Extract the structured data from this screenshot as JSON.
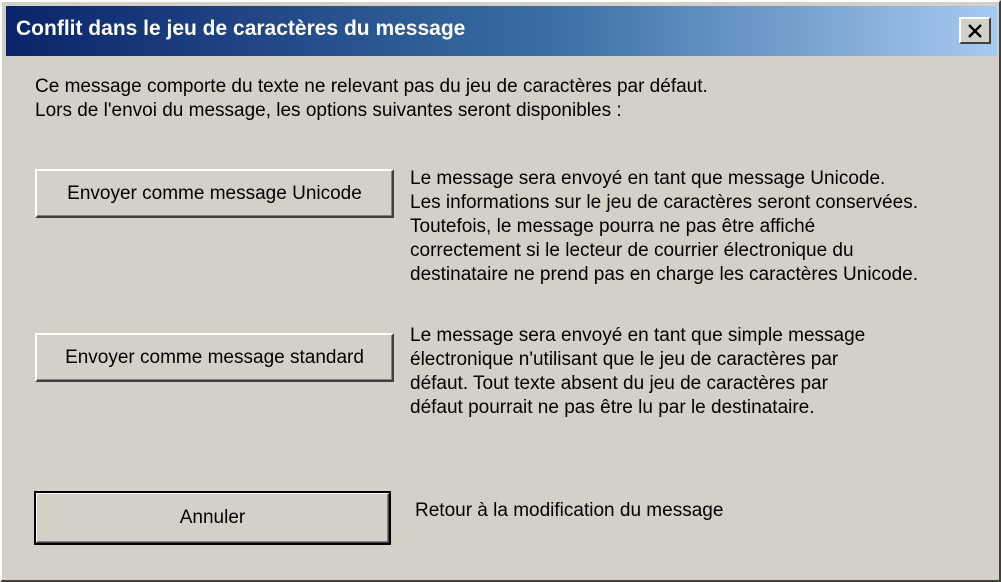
{
  "dialog": {
    "title": "Conflit dans le jeu de caractères du message",
    "intro_lines": [
      "Ce message comporte du texte ne relevant pas du jeu de caractères par défaut.",
      "Lors de l'envoi du message, les options suivantes seront disponibles :"
    ],
    "options": [
      {
        "button_label": "Envoyer comme message Unicode",
        "description_lines": [
          "Le message sera envoyé en tant que message Unicode.",
          "Les informations sur le jeu de caractères seront conservées.",
          "Toutefois, le message pourra ne pas être affiché",
          "correctement si le lecteur de courrier électronique du",
          "destinataire ne prend pas en charge les caractères Unicode."
        ]
      },
      {
        "button_label": "Envoyer comme message standard",
        "description_lines": [
          "Le message sera envoyé en tant que simple message",
          "électronique n'utilisant que le jeu de caractères par",
          "défaut. Tout texte absent du jeu de caractères par",
          "défaut pourrait ne pas être lu par le destinataire."
        ]
      },
      {
        "button_label": "Annuler",
        "description_lines": [
          "Retour à la modification du message"
        ]
      }
    ],
    "close_icon": "close-icon",
    "colors": {
      "titlebar_start": "#0a246a",
      "titlebar_end": "#a6caf0",
      "face": "#d4d0c8"
    }
  }
}
